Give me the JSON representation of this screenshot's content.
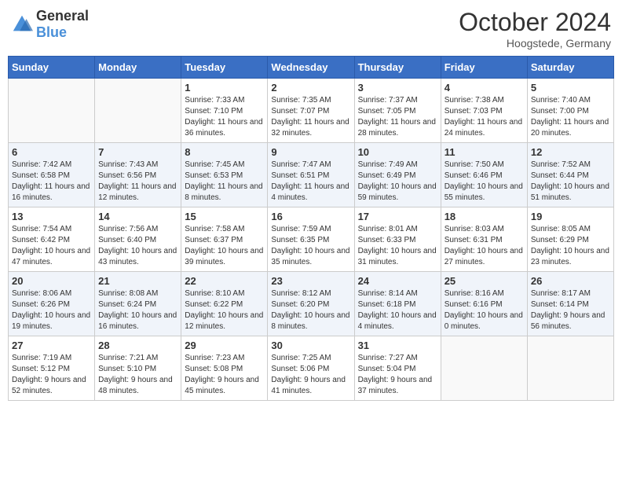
{
  "header": {
    "logo_general": "General",
    "logo_blue": "Blue",
    "month": "October 2024",
    "location": "Hoogstede, Germany"
  },
  "weekdays": [
    "Sunday",
    "Monday",
    "Tuesday",
    "Wednesday",
    "Thursday",
    "Friday",
    "Saturday"
  ],
  "weeks": [
    [
      {
        "day": "",
        "info": ""
      },
      {
        "day": "",
        "info": ""
      },
      {
        "day": "1",
        "info": "Sunrise: 7:33 AM\nSunset: 7:10 PM\nDaylight: 11 hours and 36 minutes."
      },
      {
        "day": "2",
        "info": "Sunrise: 7:35 AM\nSunset: 7:07 PM\nDaylight: 11 hours and 32 minutes."
      },
      {
        "day": "3",
        "info": "Sunrise: 7:37 AM\nSunset: 7:05 PM\nDaylight: 11 hours and 28 minutes."
      },
      {
        "day": "4",
        "info": "Sunrise: 7:38 AM\nSunset: 7:03 PM\nDaylight: 11 hours and 24 minutes."
      },
      {
        "day": "5",
        "info": "Sunrise: 7:40 AM\nSunset: 7:00 PM\nDaylight: 11 hours and 20 minutes."
      }
    ],
    [
      {
        "day": "6",
        "info": "Sunrise: 7:42 AM\nSunset: 6:58 PM\nDaylight: 11 hours and 16 minutes."
      },
      {
        "day": "7",
        "info": "Sunrise: 7:43 AM\nSunset: 6:56 PM\nDaylight: 11 hours and 12 minutes."
      },
      {
        "day": "8",
        "info": "Sunrise: 7:45 AM\nSunset: 6:53 PM\nDaylight: 11 hours and 8 minutes."
      },
      {
        "day": "9",
        "info": "Sunrise: 7:47 AM\nSunset: 6:51 PM\nDaylight: 11 hours and 4 minutes."
      },
      {
        "day": "10",
        "info": "Sunrise: 7:49 AM\nSunset: 6:49 PM\nDaylight: 10 hours and 59 minutes."
      },
      {
        "day": "11",
        "info": "Sunrise: 7:50 AM\nSunset: 6:46 PM\nDaylight: 10 hours and 55 minutes."
      },
      {
        "day": "12",
        "info": "Sunrise: 7:52 AM\nSunset: 6:44 PM\nDaylight: 10 hours and 51 minutes."
      }
    ],
    [
      {
        "day": "13",
        "info": "Sunrise: 7:54 AM\nSunset: 6:42 PM\nDaylight: 10 hours and 47 minutes."
      },
      {
        "day": "14",
        "info": "Sunrise: 7:56 AM\nSunset: 6:40 PM\nDaylight: 10 hours and 43 minutes."
      },
      {
        "day": "15",
        "info": "Sunrise: 7:58 AM\nSunset: 6:37 PM\nDaylight: 10 hours and 39 minutes."
      },
      {
        "day": "16",
        "info": "Sunrise: 7:59 AM\nSunset: 6:35 PM\nDaylight: 10 hours and 35 minutes."
      },
      {
        "day": "17",
        "info": "Sunrise: 8:01 AM\nSunset: 6:33 PM\nDaylight: 10 hours and 31 minutes."
      },
      {
        "day": "18",
        "info": "Sunrise: 8:03 AM\nSunset: 6:31 PM\nDaylight: 10 hours and 27 minutes."
      },
      {
        "day": "19",
        "info": "Sunrise: 8:05 AM\nSunset: 6:29 PM\nDaylight: 10 hours and 23 minutes."
      }
    ],
    [
      {
        "day": "20",
        "info": "Sunrise: 8:06 AM\nSunset: 6:26 PM\nDaylight: 10 hours and 19 minutes."
      },
      {
        "day": "21",
        "info": "Sunrise: 8:08 AM\nSunset: 6:24 PM\nDaylight: 10 hours and 16 minutes."
      },
      {
        "day": "22",
        "info": "Sunrise: 8:10 AM\nSunset: 6:22 PM\nDaylight: 10 hours and 12 minutes."
      },
      {
        "day": "23",
        "info": "Sunrise: 8:12 AM\nSunset: 6:20 PM\nDaylight: 10 hours and 8 minutes."
      },
      {
        "day": "24",
        "info": "Sunrise: 8:14 AM\nSunset: 6:18 PM\nDaylight: 10 hours and 4 minutes."
      },
      {
        "day": "25",
        "info": "Sunrise: 8:16 AM\nSunset: 6:16 PM\nDaylight: 10 hours and 0 minutes."
      },
      {
        "day": "26",
        "info": "Sunrise: 8:17 AM\nSunset: 6:14 PM\nDaylight: 9 hours and 56 minutes."
      }
    ],
    [
      {
        "day": "27",
        "info": "Sunrise: 7:19 AM\nSunset: 5:12 PM\nDaylight: 9 hours and 52 minutes."
      },
      {
        "day": "28",
        "info": "Sunrise: 7:21 AM\nSunset: 5:10 PM\nDaylight: 9 hours and 48 minutes."
      },
      {
        "day": "29",
        "info": "Sunrise: 7:23 AM\nSunset: 5:08 PM\nDaylight: 9 hours and 45 minutes."
      },
      {
        "day": "30",
        "info": "Sunrise: 7:25 AM\nSunset: 5:06 PM\nDaylight: 9 hours and 41 minutes."
      },
      {
        "day": "31",
        "info": "Sunrise: 7:27 AM\nSunset: 5:04 PM\nDaylight: 9 hours and 37 minutes."
      },
      {
        "day": "",
        "info": ""
      },
      {
        "day": "",
        "info": ""
      }
    ]
  ]
}
